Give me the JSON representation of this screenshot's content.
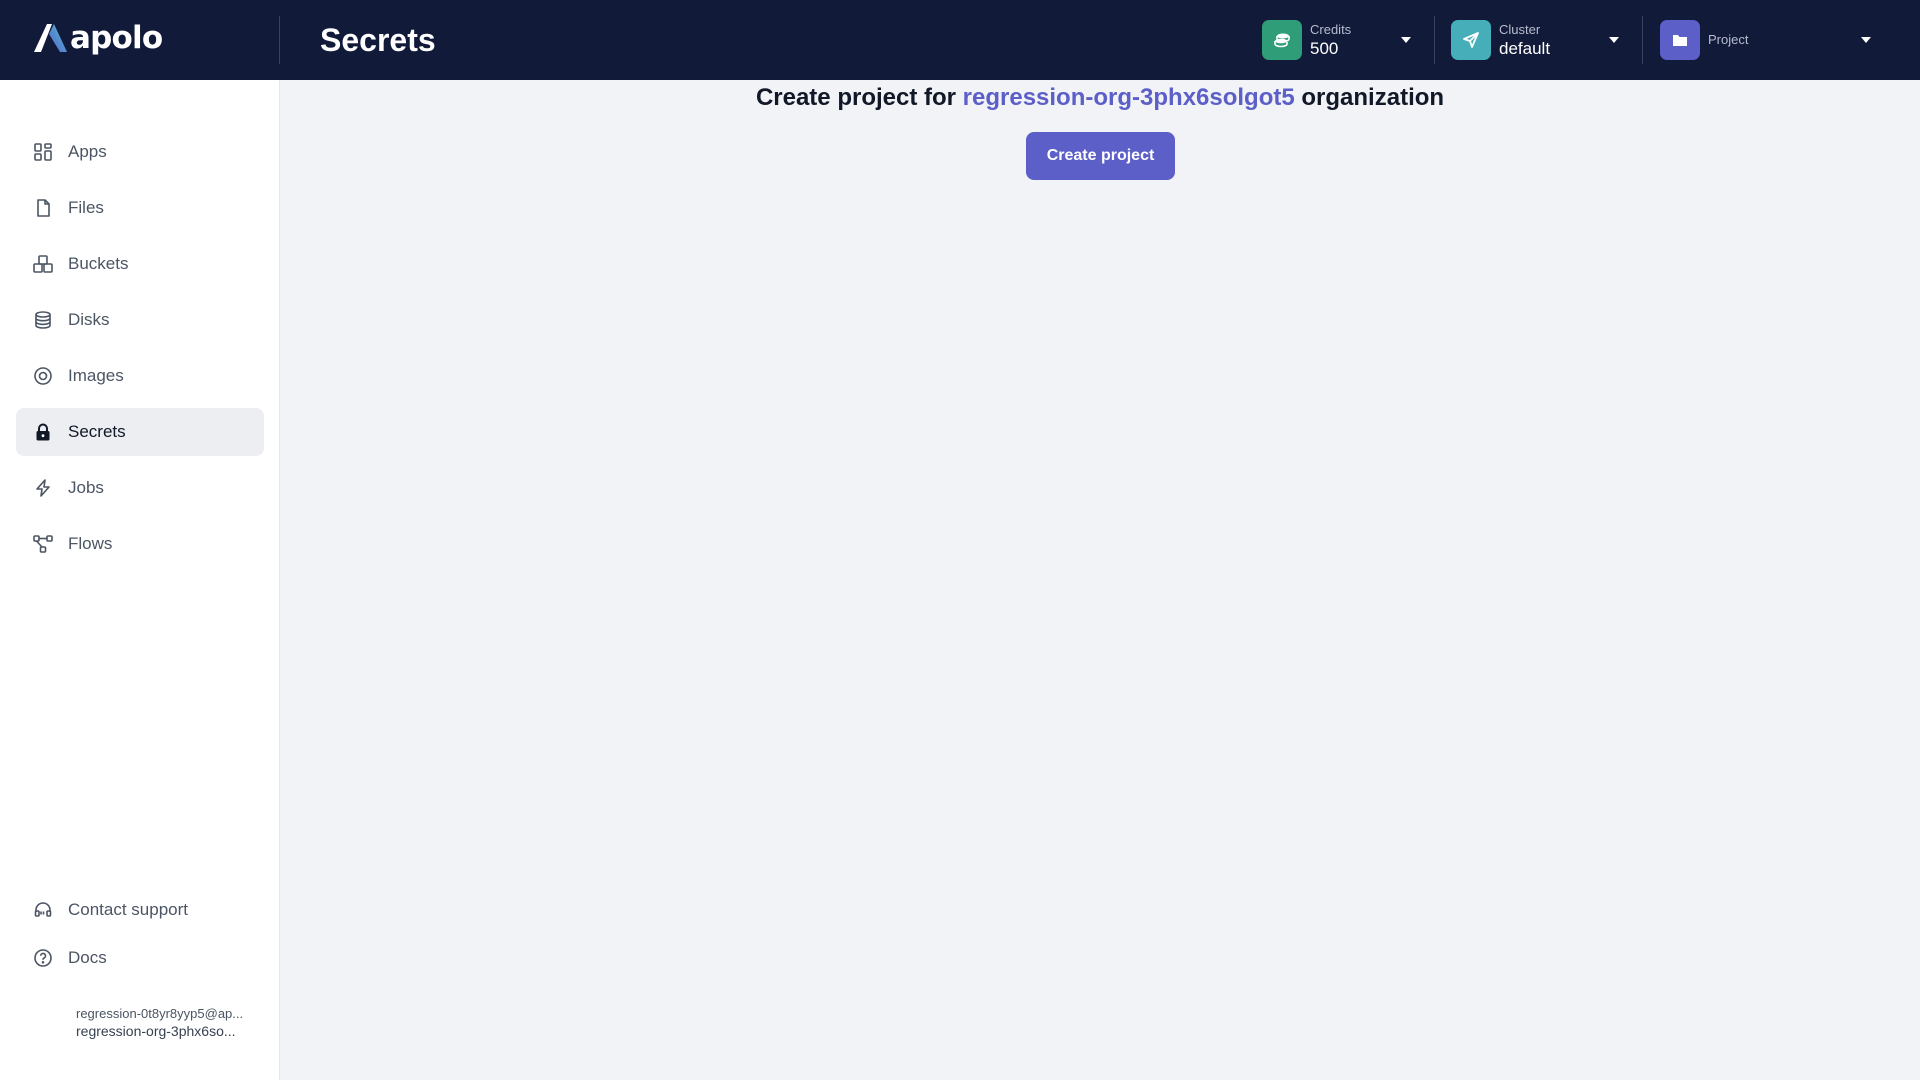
{
  "app": {
    "logo_text": "apolo"
  },
  "header": {
    "title": "Secrets",
    "credits": {
      "label": "Credits",
      "value": "500",
      "color": "#2e9d78"
    },
    "cluster": {
      "label": "Cluster",
      "value": "default",
      "color": "#45aeb8"
    },
    "project": {
      "label": "Project",
      "color": "#5b5fc7"
    }
  },
  "sidebar": {
    "items": [
      {
        "label": "Apps",
        "icon": "apps-icon"
      },
      {
        "label": "Files",
        "icon": "file-icon"
      },
      {
        "label": "Buckets",
        "icon": "buckets-icon"
      },
      {
        "label": "Disks",
        "icon": "database-icon"
      },
      {
        "label": "Images",
        "icon": "image-icon"
      },
      {
        "label": "Secrets",
        "icon": "lock-icon",
        "active": true
      },
      {
        "label": "Jobs",
        "icon": "lightning-icon"
      },
      {
        "label": "Flows",
        "icon": "flows-icon"
      }
    ],
    "support_label": "Contact support",
    "docs_label": "Docs",
    "user_email": "regression-0t8yr8yyp5@ap...",
    "user_org": "regression-org-3phx6so..."
  },
  "main": {
    "headline_prefix": "Create project for ",
    "org_name": "regression-org-3phx6solgot5",
    "headline_suffix": " organization",
    "create_button": "Create project"
  },
  "colors": {
    "accent": "#5b5fc7",
    "topbar_bg": "#121a3a",
    "page_bg": "#f2f3f6"
  }
}
